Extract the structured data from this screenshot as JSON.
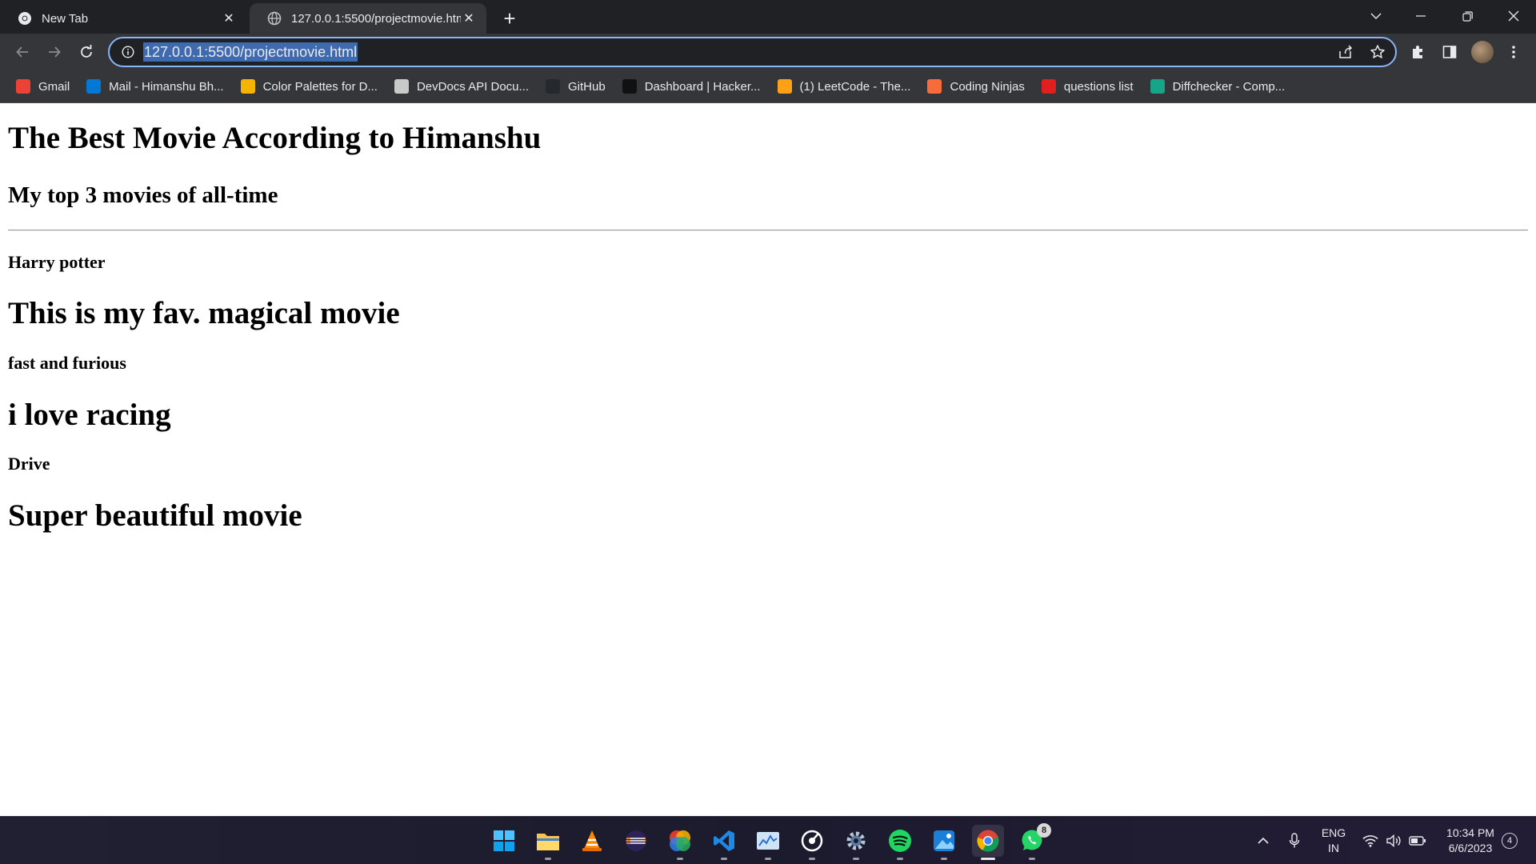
{
  "browser": {
    "tabs": [
      {
        "title": "New Tab",
        "icon": "chrome-icon",
        "active": false
      },
      {
        "title": "127.0.0.1:5500/projectmovie.html",
        "icon": "globe-icon",
        "active": true
      }
    ],
    "address": "127.0.0.1:5500/projectmovie.html",
    "bookmarks": [
      {
        "label": "Gmail",
        "icon": "gmail-icon",
        "color": "#ea4335"
      },
      {
        "label": "Mail - Himanshu Bh...",
        "icon": "outlook-icon",
        "color": "#0078d4"
      },
      {
        "label": "Color Palettes for D...",
        "icon": "palette-icon",
        "color": "#f4b400"
      },
      {
        "label": "DevDocs API Docu...",
        "icon": "devdocs-icon",
        "color": "#c9c9c9"
      },
      {
        "label": "GitHub",
        "icon": "github-icon",
        "color": "#24292e"
      },
      {
        "label": "Dashboard | Hacker...",
        "icon": "hackerrank-icon",
        "color": "#111111"
      },
      {
        "label": "(1) LeetCode - The...",
        "icon": "leetcode-icon",
        "color": "#ffa116"
      },
      {
        "label": "Coding Ninjas",
        "icon": "codingninjas-icon",
        "color": "#f66c3b"
      },
      {
        "label": "questions list",
        "icon": "tuf-icon",
        "color": "#e02020"
      },
      {
        "label": "Diffchecker - Comp...",
        "icon": "diffchecker-icon",
        "color": "#17a589"
      }
    ],
    "accent": "#8ab4f8"
  },
  "page": {
    "title": "The Best Movie According to Himanshu",
    "subtitle": "My top 3 movies of all-time",
    "movies": [
      {
        "name": "Harry potter",
        "description": "This is my fav. magical movie"
      },
      {
        "name": "fast and furious",
        "description": "i love racing"
      },
      {
        "name": "Drive",
        "description": "Super beautiful movie"
      }
    ]
  },
  "taskbar": {
    "apps": [
      "start-icon",
      "file-explorer-icon",
      "vlc-icon",
      "eclipse-icon",
      "color-wheel-icon",
      "vscode-icon",
      "task-manager-icon",
      "media-player-icon",
      "settings-icon",
      "spotify-icon",
      "photos-icon",
      "chrome-icon",
      "whatsapp-icon"
    ],
    "whatsapp_badge": "8",
    "language_line1": "ENG",
    "language_line2": "IN",
    "time": "10:34 PM",
    "date": "6/6/2023",
    "notifications": "4"
  }
}
